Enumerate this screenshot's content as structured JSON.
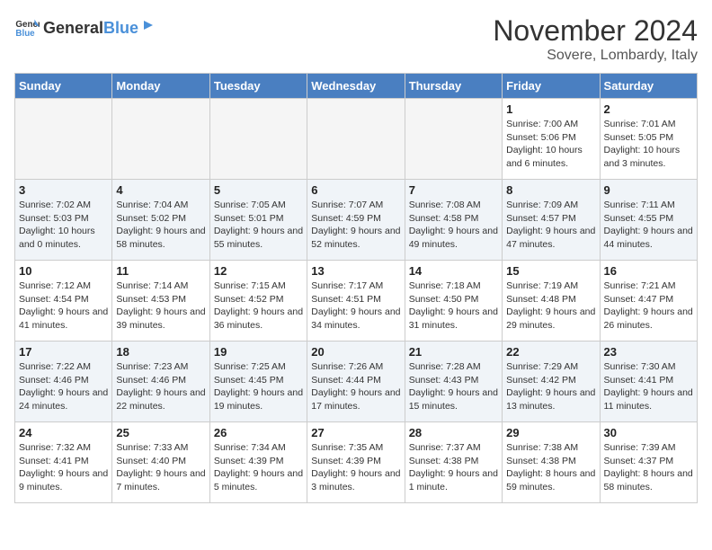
{
  "header": {
    "logo_general": "General",
    "logo_blue": "Blue",
    "month_title": "November 2024",
    "subtitle": "Sovere, Lombardy, Italy"
  },
  "calendar": {
    "days_of_week": [
      "Sunday",
      "Monday",
      "Tuesday",
      "Wednesday",
      "Thursday",
      "Friday",
      "Saturday"
    ],
    "weeks": [
      [
        {
          "day": "",
          "info": ""
        },
        {
          "day": "",
          "info": ""
        },
        {
          "day": "",
          "info": ""
        },
        {
          "day": "",
          "info": ""
        },
        {
          "day": "",
          "info": ""
        },
        {
          "day": "1",
          "info": "Sunrise: 7:00 AM\nSunset: 5:06 PM\nDaylight: 10 hours and 6 minutes."
        },
        {
          "day": "2",
          "info": "Sunrise: 7:01 AM\nSunset: 5:05 PM\nDaylight: 10 hours and 3 minutes."
        }
      ],
      [
        {
          "day": "3",
          "info": "Sunrise: 7:02 AM\nSunset: 5:03 PM\nDaylight: 10 hours and 0 minutes."
        },
        {
          "day": "4",
          "info": "Sunrise: 7:04 AM\nSunset: 5:02 PM\nDaylight: 9 hours and 58 minutes."
        },
        {
          "day": "5",
          "info": "Sunrise: 7:05 AM\nSunset: 5:01 PM\nDaylight: 9 hours and 55 minutes."
        },
        {
          "day": "6",
          "info": "Sunrise: 7:07 AM\nSunset: 4:59 PM\nDaylight: 9 hours and 52 minutes."
        },
        {
          "day": "7",
          "info": "Sunrise: 7:08 AM\nSunset: 4:58 PM\nDaylight: 9 hours and 49 minutes."
        },
        {
          "day": "8",
          "info": "Sunrise: 7:09 AM\nSunset: 4:57 PM\nDaylight: 9 hours and 47 minutes."
        },
        {
          "day": "9",
          "info": "Sunrise: 7:11 AM\nSunset: 4:55 PM\nDaylight: 9 hours and 44 minutes."
        }
      ],
      [
        {
          "day": "10",
          "info": "Sunrise: 7:12 AM\nSunset: 4:54 PM\nDaylight: 9 hours and 41 minutes."
        },
        {
          "day": "11",
          "info": "Sunrise: 7:14 AM\nSunset: 4:53 PM\nDaylight: 9 hours and 39 minutes."
        },
        {
          "day": "12",
          "info": "Sunrise: 7:15 AM\nSunset: 4:52 PM\nDaylight: 9 hours and 36 minutes."
        },
        {
          "day": "13",
          "info": "Sunrise: 7:17 AM\nSunset: 4:51 PM\nDaylight: 9 hours and 34 minutes."
        },
        {
          "day": "14",
          "info": "Sunrise: 7:18 AM\nSunset: 4:50 PM\nDaylight: 9 hours and 31 minutes."
        },
        {
          "day": "15",
          "info": "Sunrise: 7:19 AM\nSunset: 4:48 PM\nDaylight: 9 hours and 29 minutes."
        },
        {
          "day": "16",
          "info": "Sunrise: 7:21 AM\nSunset: 4:47 PM\nDaylight: 9 hours and 26 minutes."
        }
      ],
      [
        {
          "day": "17",
          "info": "Sunrise: 7:22 AM\nSunset: 4:46 PM\nDaylight: 9 hours and 24 minutes."
        },
        {
          "day": "18",
          "info": "Sunrise: 7:23 AM\nSunset: 4:46 PM\nDaylight: 9 hours and 22 minutes."
        },
        {
          "day": "19",
          "info": "Sunrise: 7:25 AM\nSunset: 4:45 PM\nDaylight: 9 hours and 19 minutes."
        },
        {
          "day": "20",
          "info": "Sunrise: 7:26 AM\nSunset: 4:44 PM\nDaylight: 9 hours and 17 minutes."
        },
        {
          "day": "21",
          "info": "Sunrise: 7:28 AM\nSunset: 4:43 PM\nDaylight: 9 hours and 15 minutes."
        },
        {
          "day": "22",
          "info": "Sunrise: 7:29 AM\nSunset: 4:42 PM\nDaylight: 9 hours and 13 minutes."
        },
        {
          "day": "23",
          "info": "Sunrise: 7:30 AM\nSunset: 4:41 PM\nDaylight: 9 hours and 11 minutes."
        }
      ],
      [
        {
          "day": "24",
          "info": "Sunrise: 7:32 AM\nSunset: 4:41 PM\nDaylight: 9 hours and 9 minutes."
        },
        {
          "day": "25",
          "info": "Sunrise: 7:33 AM\nSunset: 4:40 PM\nDaylight: 9 hours and 7 minutes."
        },
        {
          "day": "26",
          "info": "Sunrise: 7:34 AM\nSunset: 4:39 PM\nDaylight: 9 hours and 5 minutes."
        },
        {
          "day": "27",
          "info": "Sunrise: 7:35 AM\nSunset: 4:39 PM\nDaylight: 9 hours and 3 minutes."
        },
        {
          "day": "28",
          "info": "Sunrise: 7:37 AM\nSunset: 4:38 PM\nDaylight: 9 hours and 1 minute."
        },
        {
          "day": "29",
          "info": "Sunrise: 7:38 AM\nSunset: 4:38 PM\nDaylight: 8 hours and 59 minutes."
        },
        {
          "day": "30",
          "info": "Sunrise: 7:39 AM\nSunset: 4:37 PM\nDaylight: 8 hours and 58 minutes."
        }
      ]
    ]
  }
}
